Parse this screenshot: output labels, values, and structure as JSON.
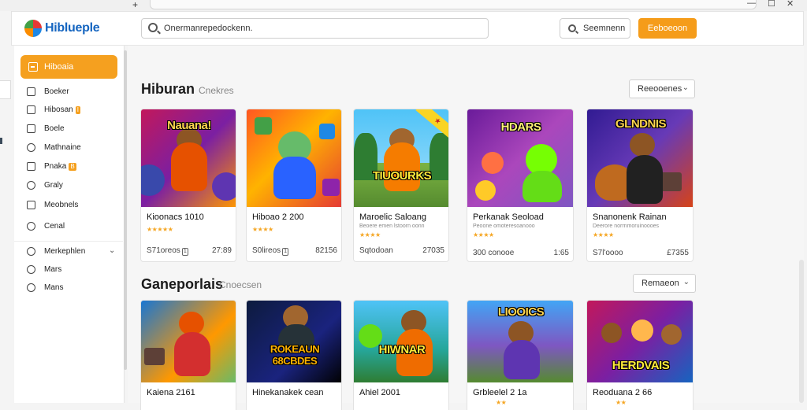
{
  "window": {
    "new_tab": "+",
    "minimize": "—",
    "maximize": "☐",
    "close": "✕"
  },
  "header": {
    "brand": "Hiblueple",
    "search_value": "Onermanrepedockenn.",
    "search_button": "Seemnenn",
    "primary_button": "Eeboeoon"
  },
  "sidebar": {
    "active": "Hiboaia",
    "items": [
      {
        "label": "Boeker",
        "badge": ""
      },
      {
        "label": "Hibosan",
        "badge": "I"
      },
      {
        "label": "Boele",
        "badge": ""
      },
      {
        "label": "Mathnaine",
        "badge": ""
      },
      {
        "label": "Pnaka",
        "badge": "B"
      },
      {
        "label": "Graly",
        "badge": ""
      },
      {
        "label": "Meobnels",
        "badge": ""
      },
      {
        "label": "Cenal",
        "badge": ""
      },
      {
        "label": "Merkephlen",
        "badge": ""
      },
      {
        "label": "Mars",
        "badge": ""
      },
      {
        "label": "Mans",
        "badge": ""
      }
    ]
  },
  "sections": [
    {
      "title": "Hiburan",
      "subtitle": "Cnekres",
      "dropdown": "Reeooenes",
      "cards": [
        {
          "art": "Nauana!",
          "name": "Kioonacs 1010",
          "meta": "",
          "stars": "★★★★★",
          "foot_left": "S71oreos",
          "tag": "1",
          "foot_right": "27:89"
        },
        {
          "art": "",
          "name": "Hiboao 2 200",
          "meta": "",
          "stars": "★★★★",
          "foot_left": "S0lireos",
          "tag": "1",
          "foot_right": "82156"
        },
        {
          "art": "TIUOURKS",
          "name": "Maroelic Saloang",
          "meta": "Beoere emen lstoorn oonn",
          "stars": "★★★★",
          "foot_left": "Sqtodoan",
          "tag": "",
          "foot_right": "27035"
        },
        {
          "art": "HDARS",
          "name": "Perkanak Seoload",
          "meta": "Peoone omoteresoanooo",
          "stars": "★★★★",
          "foot_left": "300 conooe",
          "tag": "",
          "foot_right": "1:65"
        },
        {
          "art": "GLNDNIS",
          "name": "Snanonenk Rainan",
          "meta": "Deerore norrnmoruinoooes",
          "stars": "★★★★",
          "foot_left": "S7l'oooo",
          "tag": "",
          "foot_right": "£7355"
        }
      ]
    },
    {
      "title": "Ganeporlais",
      "subtitle": "Cnoecsen",
      "dropdown": "Remaeon",
      "cards": [
        {
          "art": "",
          "name": "Kaiena 2161",
          "stars": ""
        },
        {
          "art": "ROKEAUN 68CBDES",
          "name": "Hinekanakek cean",
          "stars": ""
        },
        {
          "art": "HIWNAR",
          "name": "Ahiel 2001",
          "stars": ""
        },
        {
          "art": "LIOOICS",
          "name": "Grbleelel 2 1a",
          "stars": "★★"
        },
        {
          "art": "HERDVAIS",
          "name": "Reoduana 2 66",
          "stars": "★★"
        }
      ]
    }
  ],
  "colors": {
    "accent": "#f5a01f",
    "brand": "#1565c0"
  }
}
